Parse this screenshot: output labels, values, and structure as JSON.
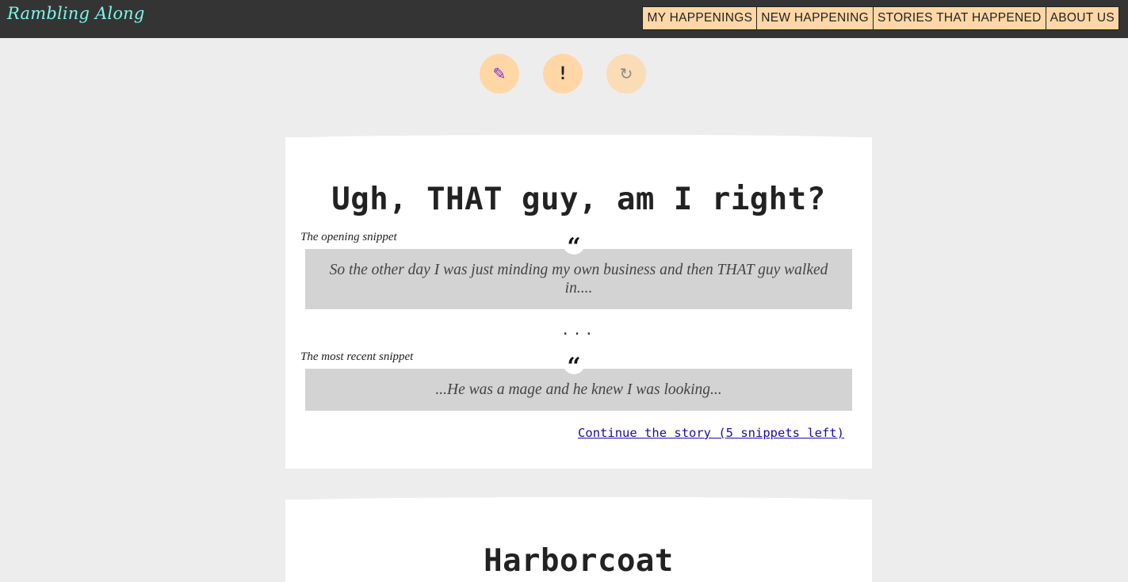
{
  "brand": "Rambling Along",
  "nav": [
    "MY HAPPENINGS",
    "NEW HAPPENING",
    "STORIES THAT HAPPENED",
    "ABOUT US"
  ],
  "actions": [
    {
      "icon": "pencil-icon",
      "glyph": "✎"
    },
    {
      "icon": "exclamation-icon",
      "glyph": "!"
    },
    {
      "icon": "refresh-icon",
      "glyph": "↻"
    }
  ],
  "stories": [
    {
      "title": "Ugh, THAT guy, am I right?",
      "opening_label": "The opening snippet",
      "opening_text": "So the other day I was just minding my own business and then THAT guy walked in....",
      "ellipsis": "...",
      "recent_label": "The most recent snippet",
      "recent_text": "...He was a mage and he knew I was looking...",
      "continue_link": "Continue the story (5 snippets left)"
    },
    {
      "title": "Harborcoat"
    }
  ],
  "quote_glyph": "“",
  "colors": {
    "navbar": "#343434",
    "brand": "#7ff5e6",
    "nav_button": "#ffd7a6",
    "page_background": "#ededed",
    "snippet_background": "#d3d3d3",
    "link": "#1a0dab"
  }
}
